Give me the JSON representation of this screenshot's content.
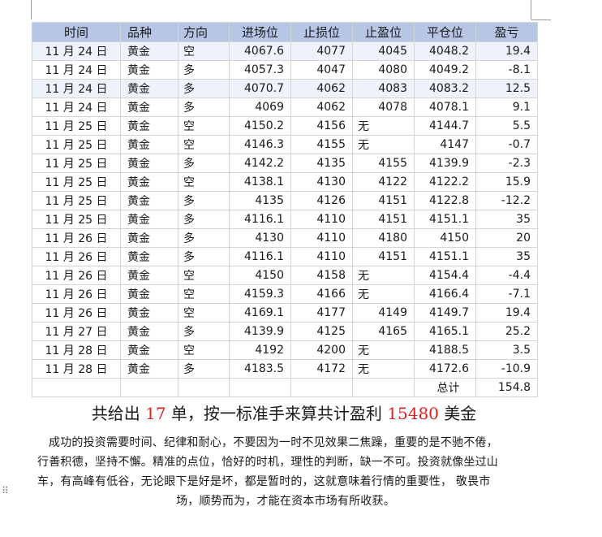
{
  "table": {
    "headers": [
      "时间",
      "品种",
      "方向",
      "进场位",
      "止损位",
      "止盈位",
      "平仓位",
      "盈亏"
    ],
    "rows": [
      [
        "11 月 24 日",
        "黄金",
        "空",
        "4067.6",
        "4077",
        "4045",
        "4048.2",
        "19.4"
      ],
      [
        "11 月 24 日",
        "黄金",
        "多",
        "4057.3",
        "4047",
        "4080",
        "4049.2",
        "-8.1"
      ],
      [
        "11 月 24 日",
        "黄金",
        "多",
        "4070.7",
        "4062",
        "4083",
        "4083.2",
        "12.5"
      ],
      [
        "11 月 24 日",
        "黄金",
        "多",
        "4069",
        "4062",
        "4078",
        "4078.1",
        "9.1"
      ],
      [
        "11 月 25 日",
        "黄金",
        "空",
        "4150.2",
        "4156",
        "无",
        "4144.7",
        "5.5"
      ],
      [
        "11 月 25 日",
        "黄金",
        "空",
        "4146.3",
        "4155",
        "无",
        "4147",
        "-0.7"
      ],
      [
        "11 月 25 日",
        "黄金",
        "多",
        "4142.2",
        "4135",
        "4155",
        "4139.9",
        "-2.3"
      ],
      [
        "11 月 25 日",
        "黄金",
        "空",
        "4138.1",
        "4130",
        "4122",
        "4122.2",
        "15.9"
      ],
      [
        "11 月 25 日",
        "黄金",
        "多",
        "4135",
        "4126",
        "4151",
        "4122.8",
        "-12.2"
      ],
      [
        "11 月 25 日",
        "黄金",
        "多",
        "4116.1",
        "4110",
        "4151",
        "4151.1",
        "35"
      ],
      [
        "11 月 26 日",
        "黄金",
        "多",
        "4130",
        "4110",
        "4180",
        "4150",
        "20"
      ],
      [
        "11 月 26 日",
        "黄金",
        "多",
        "4116.1",
        "4110",
        "4151",
        "4151.1",
        "35"
      ],
      [
        "11 月 26 日",
        "黄金",
        "空",
        "4150",
        "4158",
        "无",
        "4154.4",
        "-4.4"
      ],
      [
        "11 月 26 日",
        "黄金",
        "空",
        "4159.3",
        "4166",
        "无",
        "4166.4",
        "-7.1"
      ],
      [
        "11 月 26 日",
        "黄金",
        "空",
        "4169.1",
        "4177",
        "4149",
        "4149.7",
        "19.4"
      ],
      [
        "11 月 27 日",
        "黄金",
        "多",
        "4139.9",
        "4125",
        "4165",
        "4165.1",
        "25.2"
      ],
      [
        "11 月 28 日",
        "黄金",
        "空",
        "4192",
        "4200",
        "无",
        "4188.5",
        "3.5"
      ],
      [
        "11 月 28 日",
        "黄金",
        "多",
        "4183.5",
        "4172",
        "无",
        "4172.6",
        "-10.9"
      ]
    ],
    "total_label": "总计",
    "total_value": "154.8",
    "header_color": "#b8c6e6",
    "alt_row_color": "#eef2fb"
  },
  "summary": {
    "prefix": "共给出",
    "count": "17",
    "middle": "单，按一标准手来算共计盈利",
    "profit": "15480",
    "suffix": "美金",
    "highlight_color": "#e02020"
  },
  "paragraph": {
    "line1": "成功的投资需要时间、纪律和耐心，不要因为一时不见效果二焦躁，重要的是不驰不倦，",
    "line2": "行善积德，坚持不懈。精准的点位，恰好的时机，理性的判断，缺一不可。投资就像坐过山",
    "line3": "车，有高峰有低谷，无论眼下是好是坏，都是暂时的，这就意味着行情的重要性， 敬畏市",
    "line4": "场，顺势而为，才能在资本市场有所收获。"
  },
  "icons": {
    "drag_handle": "drag-handle-icon"
  }
}
